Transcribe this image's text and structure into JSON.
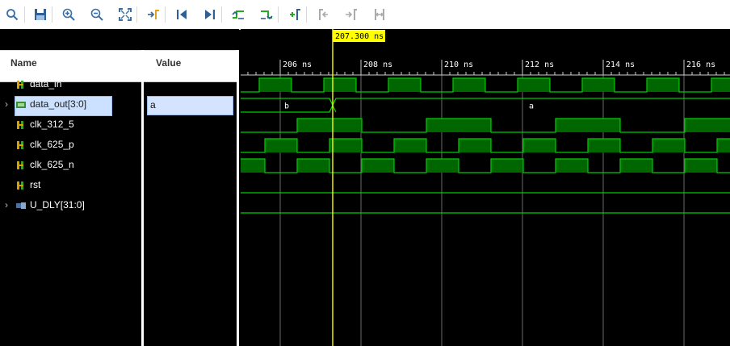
{
  "toolbar": {
    "buttons": [
      {
        "name": "search-icon",
        "enabled": true
      },
      {
        "name": "save-icon",
        "enabled": true
      },
      {
        "name": "zoom-in-icon",
        "enabled": true
      },
      {
        "name": "zoom-out-icon",
        "enabled": true
      },
      {
        "name": "zoom-fit-icon",
        "enabled": true
      },
      {
        "name": "goto-cursor-icon",
        "enabled": true
      },
      {
        "name": "go-to-start-icon",
        "enabled": true
      },
      {
        "name": "go-to-end-icon",
        "enabled": true
      },
      {
        "name": "previous-transition-icon",
        "enabled": true
      },
      {
        "name": "next-transition-icon",
        "enabled": true
      },
      {
        "name": "add-marker-icon",
        "enabled": true
      },
      {
        "name": "previous-marker-icon",
        "enabled": false
      },
      {
        "name": "next-marker-icon",
        "enabled": false
      },
      {
        "name": "swap-cursors-icon",
        "enabled": false
      }
    ]
  },
  "columns": {
    "name_header": "Name",
    "value_header": "Value"
  },
  "signals": [
    {
      "label": "data_in",
      "icon": "bit-signal-icon",
      "expandable": false,
      "value": ""
    },
    {
      "label": "data_out[3:0]",
      "icon": "bus-signal-icon",
      "expandable": true,
      "selected": true,
      "value": "a"
    },
    {
      "label": "clk_312_5",
      "icon": "bit-signal-icon",
      "expandable": false,
      "value": ""
    },
    {
      "label": "clk_625_p",
      "icon": "bit-signal-icon",
      "expandable": false,
      "value": ""
    },
    {
      "label": "clk_625_n",
      "icon": "bit-signal-icon",
      "expandable": false,
      "value": ""
    },
    {
      "label": "rst",
      "icon": "bit-signal-icon",
      "expandable": false,
      "value": ""
    },
    {
      "label": "U_DLY[31:0]",
      "icon": "group-signal-icon",
      "expandable": true,
      "value": ""
    }
  ],
  "timeline": {
    "cursor_label": "207.300 ns",
    "cursor_ns": 207.3,
    "tick_labels": [
      "206 ns",
      "208 ns",
      "210 ns",
      "212 ns",
      "214 ns",
      "216 ns"
    ],
    "major_ticks_ns": [
      206,
      208,
      210,
      212,
      214,
      216
    ],
    "view_start_ns": 205.02,
    "ns_per_major": 2
  },
  "waveforms": {
    "data_in": {
      "type": "bit",
      "period_ns": 1.6,
      "high_ns": 0.8,
      "first_rise_ns": 205.48
    },
    "clk_312_5": {
      "type": "bit",
      "period_ns": 3.2,
      "high_ns": 1.6,
      "first_rise_ns": 206.42
    },
    "clk_625_p": {
      "type": "bit",
      "period_ns": 1.6,
      "high_ns": 0.8,
      "first_rise_ns": 205.62
    },
    "clk_625_n": {
      "type": "bit",
      "period_ns": 1.6,
      "high_ns": 0.8,
      "first_rise_ns": 204.82
    },
    "rst": {
      "type": "bit",
      "constant": 0
    },
    "data_out": {
      "type": "bus",
      "segments": [
        {
          "end_ns": 207.3,
          "text": "b"
        },
        {
          "text": "a"
        }
      ]
    },
    "U_DLY": {
      "type": "bus",
      "constant": ""
    }
  },
  "colors": {
    "wave": "#00cc00",
    "high_fill": "#006600",
    "cursor": "#ffff00",
    "cursor_label_bg": "#ffff00",
    "grid": "#ffffff",
    "tick": "#cccccc"
  }
}
